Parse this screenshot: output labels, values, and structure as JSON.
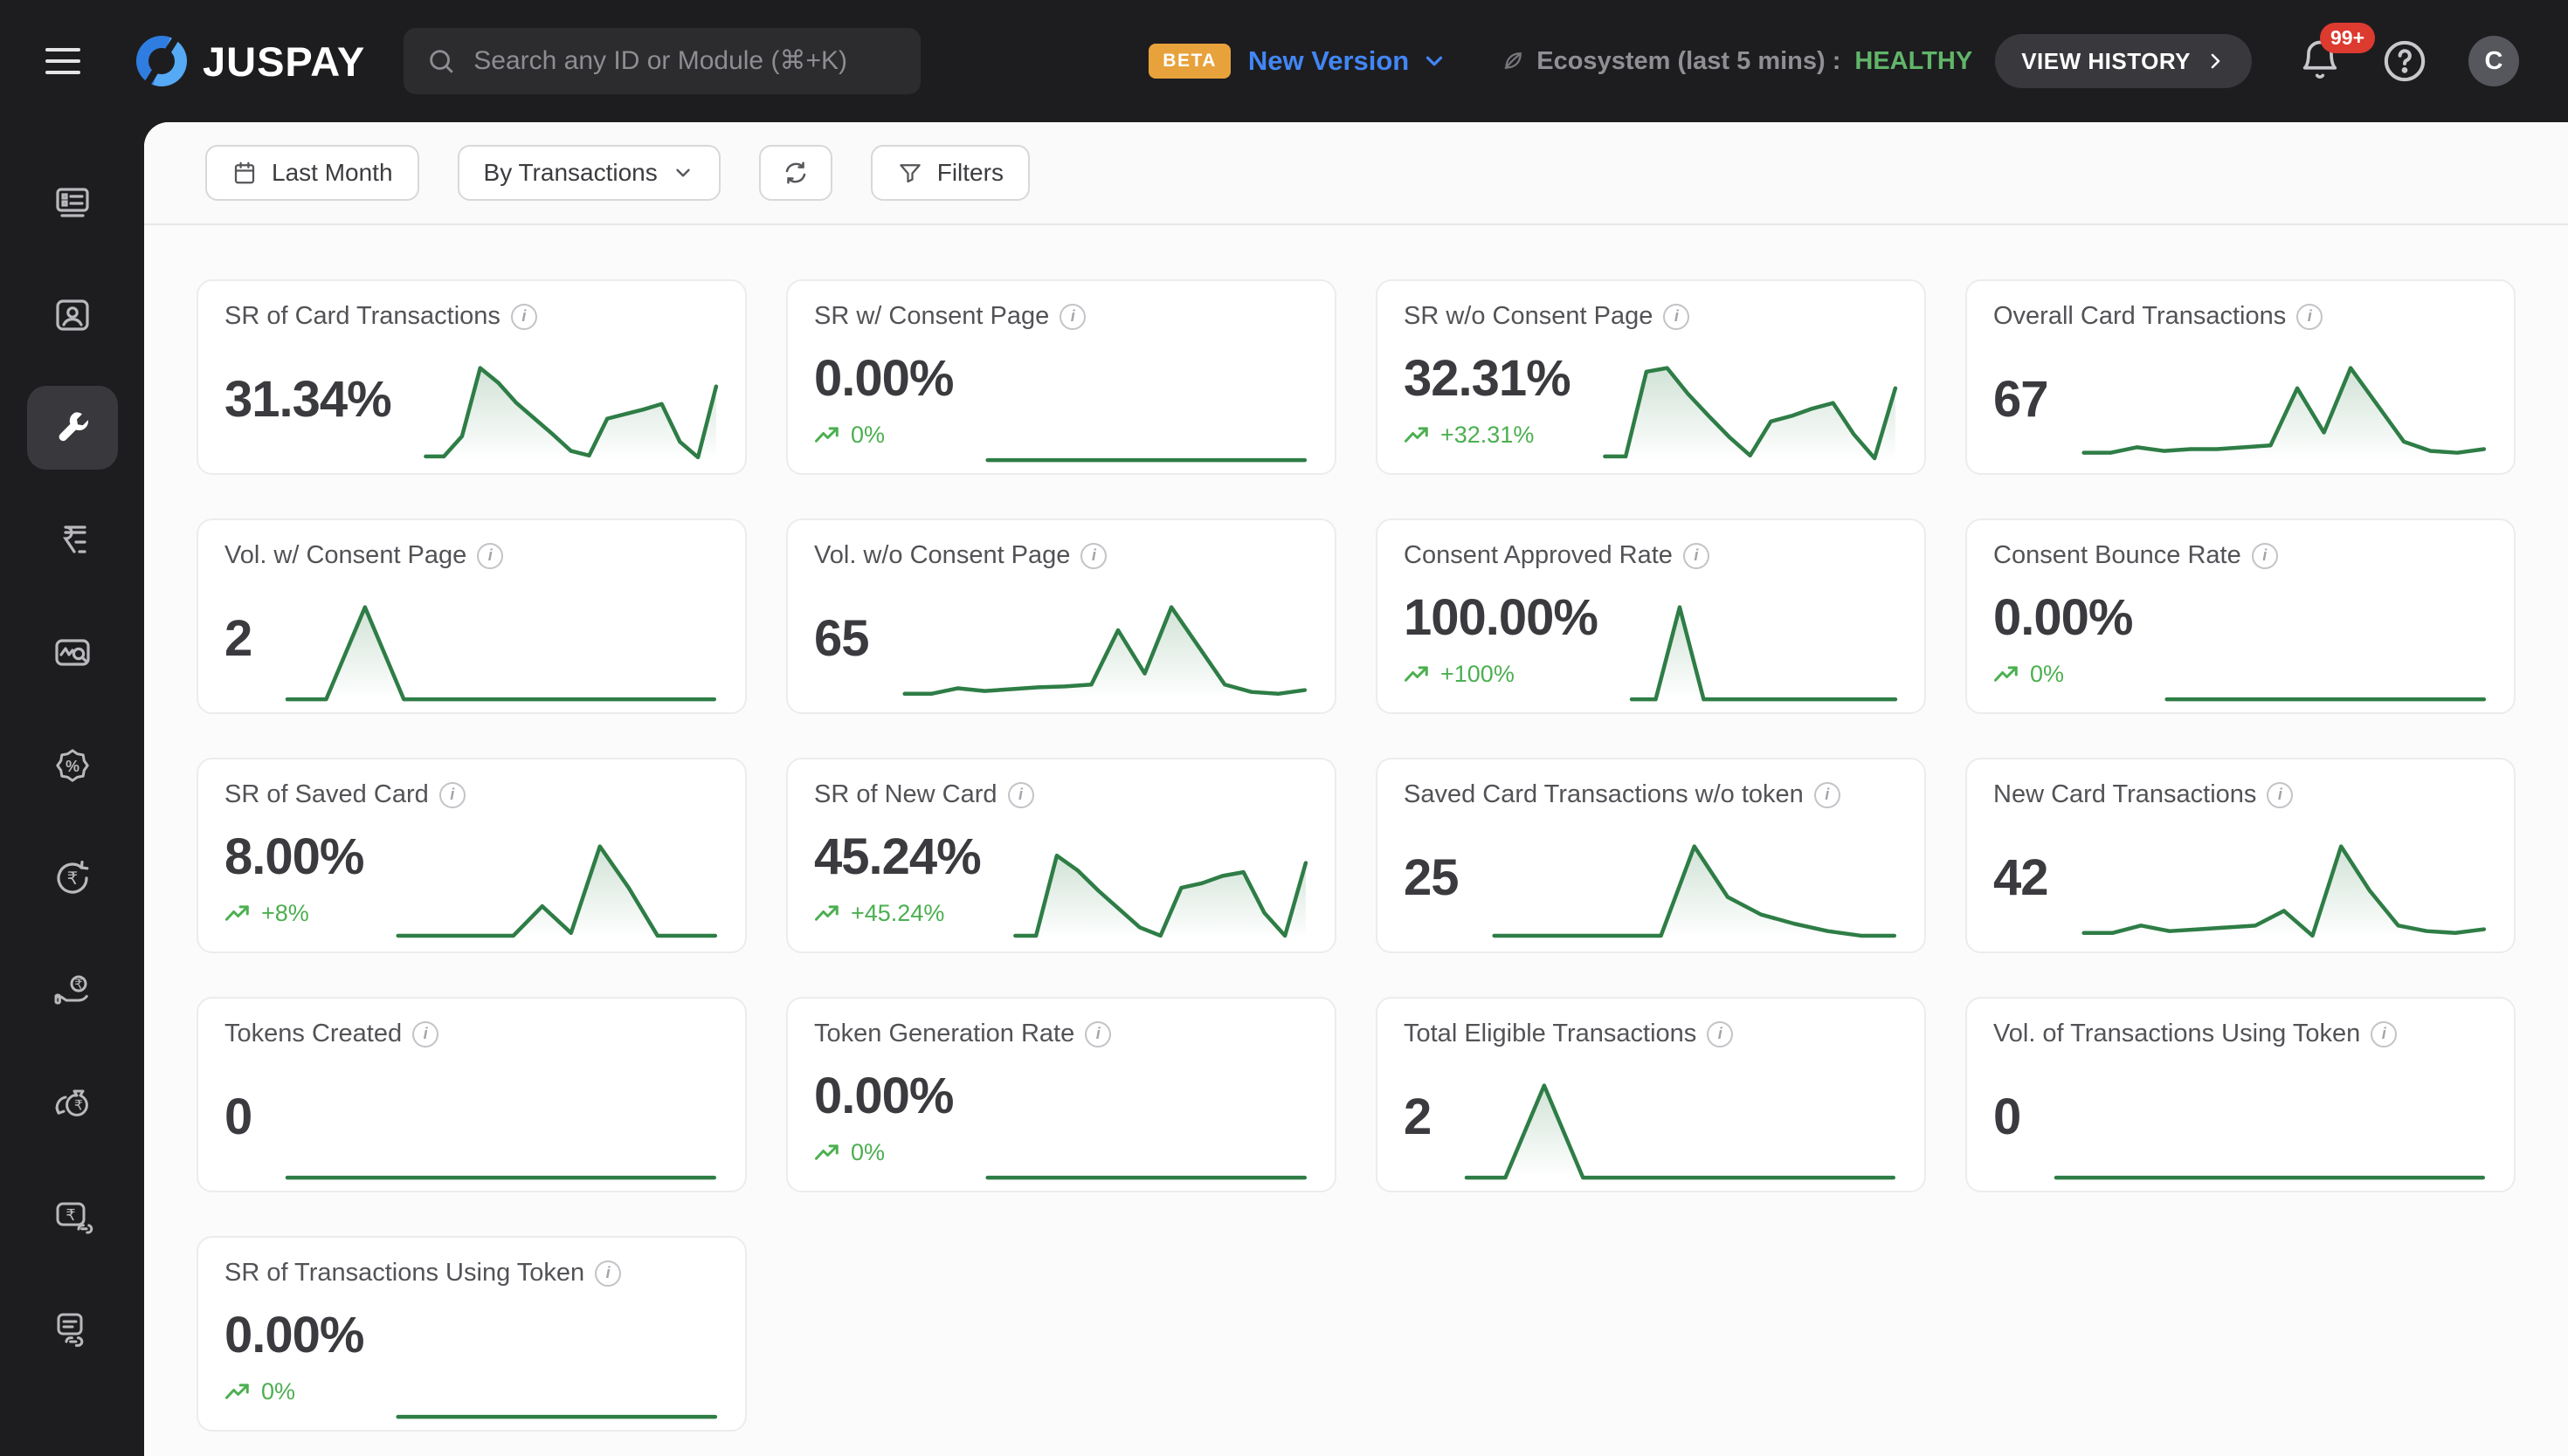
{
  "header": {
    "logo_text": "JUSPAY",
    "search_placeholder": "Search any ID or Module (⌘+K)",
    "beta_badge": "BETA",
    "version_label": "New Version",
    "ecosystem_label": "Ecosystem (last 5 mins) :",
    "ecosystem_status": "HEALTHY",
    "view_history_label": "VIEW HISTORY",
    "notification_count": "99+",
    "avatar_initial": "C"
  },
  "sidebar": {
    "items": [
      {
        "icon": "dashboard-icon",
        "active": false
      },
      {
        "icon": "customers-icon",
        "active": false
      },
      {
        "icon": "tools-icon",
        "active": true
      },
      {
        "icon": "invoices-icon",
        "active": false
      },
      {
        "icon": "analytics-icon",
        "active": false
      },
      {
        "icon": "offers-icon",
        "active": false
      },
      {
        "icon": "refunds-icon",
        "active": false
      },
      {
        "icon": "payouts-icon",
        "active": false
      },
      {
        "icon": "settlements-icon",
        "active": false
      },
      {
        "icon": "payment-links-icon",
        "active": false
      },
      {
        "icon": "reports-link-icon",
        "active": false
      }
    ]
  },
  "toolbar": {
    "date_range_label": "Last Month",
    "group_by_label": "By Transactions",
    "filters_label": "Filters"
  },
  "colors": {
    "spark_green": "#2e7d46",
    "spark_fill": "#5a9a72",
    "delta_green": "#4caf50",
    "healthy_green": "#61b56a",
    "version_blue": "#4286f5",
    "beta_orange": "#e7a23c",
    "badge_red": "#dd3a30"
  },
  "cards": [
    {
      "title": "SR of Card Transactions",
      "value": "31.34%",
      "delta": null,
      "spark": [
        4,
        4,
        26,
        100,
        84,
        62,
        45,
        28,
        10,
        5,
        45,
        50,
        55,
        61,
        20,
        3,
        80
      ]
    },
    {
      "title": "SR w/ Consent Page",
      "value": "0.00%",
      "delta": "0%",
      "spark": [
        0,
        0,
        0,
        0,
        0,
        0,
        0,
        0,
        0,
        0
      ]
    },
    {
      "title": "SR w/o Consent Page",
      "value": "32.31%",
      "delta": "+32.31%",
      "spark": [
        4,
        4,
        96,
        100,
        72,
        48,
        25,
        5,
        42,
        48,
        56,
        62,
        28,
        2,
        78
      ]
    },
    {
      "title": "Overall Card Transactions",
      "value": "67",
      "delta": null,
      "spark": [
        8,
        8,
        14,
        10,
        12,
        12,
        14,
        16,
        78,
        30,
        100,
        60,
        20,
        10,
        8,
        12
      ]
    },
    {
      "title": "Vol. w/ Consent Page",
      "value": "2",
      "delta": null,
      "spark": [
        0,
        0,
        100,
        0,
        0,
        0,
        0,
        0,
        0,
        0,
        0,
        0
      ]
    },
    {
      "title": "Vol. w/o Consent Page",
      "value": "65",
      "delta": null,
      "spark": [
        6,
        6,
        12,
        9,
        11,
        13,
        14,
        16,
        75,
        28,
        100,
        58,
        16,
        8,
        6,
        10
      ]
    },
    {
      "title": "Consent Approved Rate",
      "value": "100.00%",
      "delta": "+100%",
      "spark": [
        0,
        0,
        100,
        0,
        0,
        0,
        0,
        0,
        0,
        0,
        0,
        0
      ]
    },
    {
      "title": "Consent Bounce Rate",
      "value": "0.00%",
      "delta": "0%",
      "spark": [
        0,
        0,
        0,
        0,
        0,
        0,
        0,
        0,
        0,
        0
      ]
    },
    {
      "title": "SR of Saved Card",
      "value": "8.00%",
      "delta": "+8%",
      "spark": [
        3,
        3,
        3,
        3,
        3,
        35,
        6,
        100,
        55,
        3,
        3,
        3
      ]
    },
    {
      "title": "SR of New Card",
      "value": "45.24%",
      "delta": "+45.24%",
      "spark": [
        3,
        3,
        90,
        74,
        52,
        32,
        12,
        3,
        55,
        60,
        68,
        72,
        28,
        3,
        82
      ]
    },
    {
      "title": "Saved Card Transactions w/o token",
      "value": "25",
      "delta": null,
      "spark": [
        3,
        3,
        3,
        3,
        3,
        3,
        100,
        45,
        26,
        16,
        8,
        3,
        3
      ]
    },
    {
      "title": "New Card Transactions",
      "value": "42",
      "delta": null,
      "spark": [
        6,
        6,
        14,
        8,
        10,
        12,
        14,
        30,
        3,
        100,
        52,
        14,
        8,
        6,
        10
      ]
    },
    {
      "title": "Tokens Created",
      "value": "0",
      "delta": null,
      "spark": [
        0,
        0,
        0,
        0,
        0,
        0,
        0,
        0,
        0,
        0
      ]
    },
    {
      "title": "Token Generation Rate",
      "value": "0.00%",
      "delta": "0%",
      "spark": [
        0,
        0,
        0,
        0,
        0,
        0,
        0,
        0,
        0,
        0
      ]
    },
    {
      "title": "Total Eligible Transactions",
      "value": "2",
      "delta": null,
      "spark": [
        0,
        0,
        100,
        0,
        0,
        0,
        0,
        0,
        0,
        0,
        0,
        0
      ]
    },
    {
      "title": "Vol. of Transactions Using Token",
      "value": "0",
      "delta": null,
      "spark": [
        0,
        0,
        0,
        0,
        0,
        0,
        0,
        0,
        0,
        0
      ]
    },
    {
      "title": "SR of Transactions Using Token",
      "value": "0.00%",
      "delta": "0%",
      "spark": [
        0,
        0,
        0,
        0,
        0,
        0,
        0,
        0,
        0,
        0
      ]
    }
  ]
}
